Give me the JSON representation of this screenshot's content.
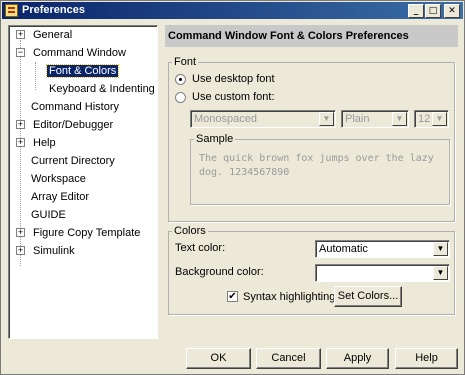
{
  "window": {
    "title": "Preferences"
  },
  "tree": {
    "items": [
      {
        "label": "General"
      },
      {
        "label": "Command Window"
      },
      {
        "label": "Font & Colors"
      },
      {
        "label": "Keyboard & Indenting"
      },
      {
        "label": "Command History"
      },
      {
        "label": "Editor/Debugger"
      },
      {
        "label": "Help"
      },
      {
        "label": "Current Directory"
      },
      {
        "label": "Workspace"
      },
      {
        "label": "Array Editor"
      },
      {
        "label": "GUIDE"
      },
      {
        "label": "Figure Copy Template"
      },
      {
        "label": "Simulink"
      }
    ]
  },
  "panel": {
    "title": "Command Window Font & Colors Preferences"
  },
  "font_group": {
    "title": "Font",
    "use_desktop_label": "Use desktop font",
    "use_custom_label": "Use custom font:",
    "font_name": "Monospaced",
    "font_style": "Plain",
    "font_size": "12",
    "sample_title": "Sample",
    "sample_text": "The quick brown fox jumps over the lazy dog. 1234567890"
  },
  "colors_group": {
    "title": "Colors",
    "text_color_label": "Text color:",
    "text_color_value": "Automatic",
    "background_color_label": "Background color:",
    "background_color_value": "",
    "syntax_label": "Syntax highlighting",
    "set_colors_label": "Set Colors..."
  },
  "buttons": {
    "ok": "OK",
    "cancel": "Cancel",
    "apply": "Apply",
    "help": "Help"
  },
  "icons": {
    "expander_plus": "+",
    "expander_minus": "−",
    "dropdown_arrow": "▼",
    "checkmark": "✔"
  }
}
